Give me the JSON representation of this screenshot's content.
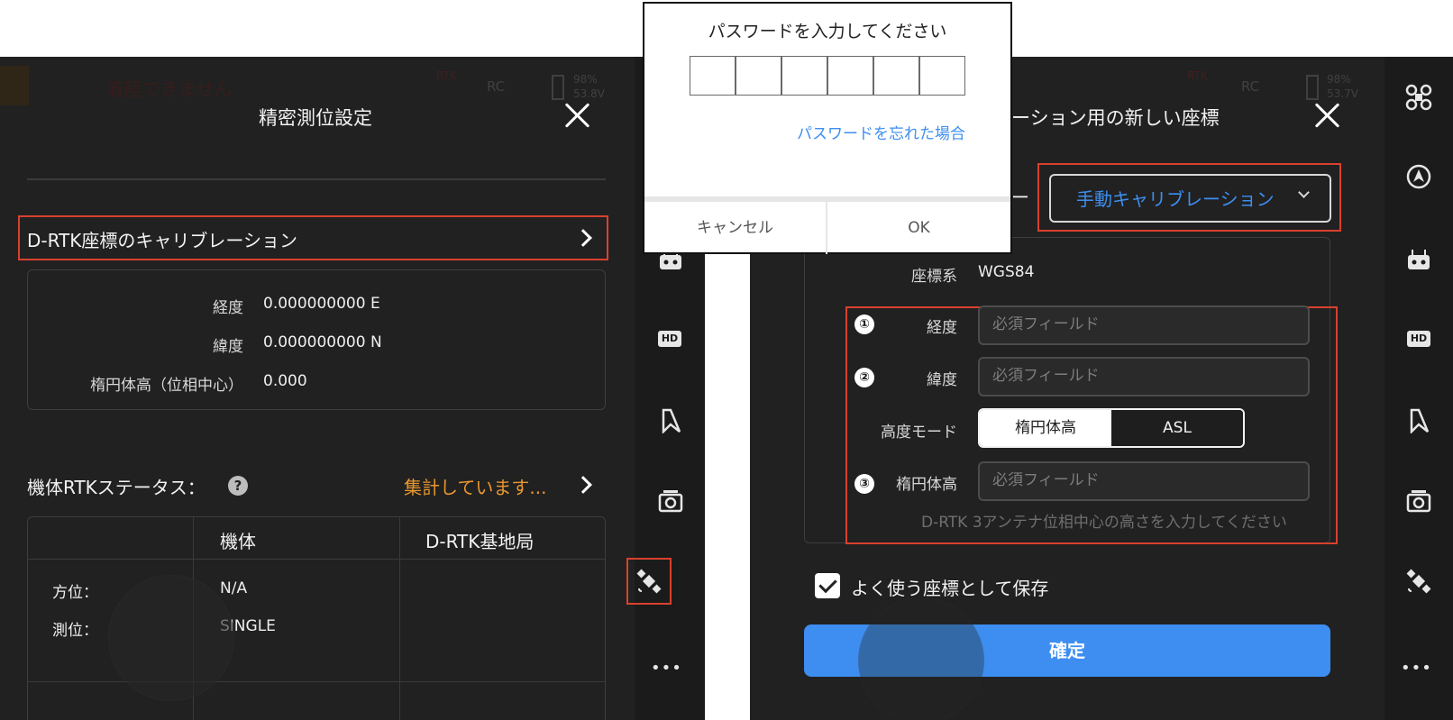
{
  "left": {
    "hud_status": "着陸できません",
    "hud_rtk": "RTK",
    "hud_rc": "RC",
    "hud_battery_pct": "98%",
    "hud_battery_volt": "53.8V",
    "title": "精密測位設定",
    "calibration_row_label": "D-RTK座標のキャリブレーション",
    "longitude_label": "経度",
    "longitude_value": "0.000000000 E",
    "latitude_label": "緯度",
    "latitude_value": "0.000000000 N",
    "ellipsoid_label": "楕円体高（位相中心）",
    "ellipsoid_value": "0.000",
    "rtk_status_label": "機体RTKステータス：",
    "rtk_status_value": "集計しています...",
    "table": {
      "columns": [
        "機体",
        "D-RTK基地局"
      ],
      "rows": [
        {
          "label": "方位：",
          "aircraft": "N/A",
          "base": ""
        },
        {
          "label": "測位：",
          "aircraft": "SINGLE",
          "base": ""
        }
      ]
    }
  },
  "right": {
    "hud_battery_pct": "98%",
    "hud_battery_volt": "53.7V",
    "title": "ーション用の新しい座標",
    "source_label_partial": "ー",
    "source_dropdown": "手動キャリブレーション",
    "coord_system_label": "座標系",
    "coord_system_value": "WGS84",
    "num1": "①",
    "num2": "②",
    "num3": "③",
    "longitude_label": "経度",
    "latitude_label": "緯度",
    "field_placeholder": "必須フィールド",
    "altitude_mode_label": "高度モード",
    "altitude_modes": [
      "楕円体高",
      "ASL"
    ],
    "ellipsoid_label": "楕円体高",
    "hint": "D-RTK 3アンテナ位相中心の高さを入力してください",
    "save_label": "よく使う座標として保存",
    "confirm_label": "確定"
  },
  "dialog": {
    "title": "パスワードを入力してください",
    "forgot": "パスワードを忘れた場合",
    "cancel": "キャンセル",
    "ok": "OK"
  },
  "sidebar": {
    "hd_label": "HD",
    "more": "•••"
  },
  "colors": {
    "accent_blue": "#3d8ef0",
    "highlight_red": "#d9412f",
    "status_orange": "#e9962f"
  }
}
